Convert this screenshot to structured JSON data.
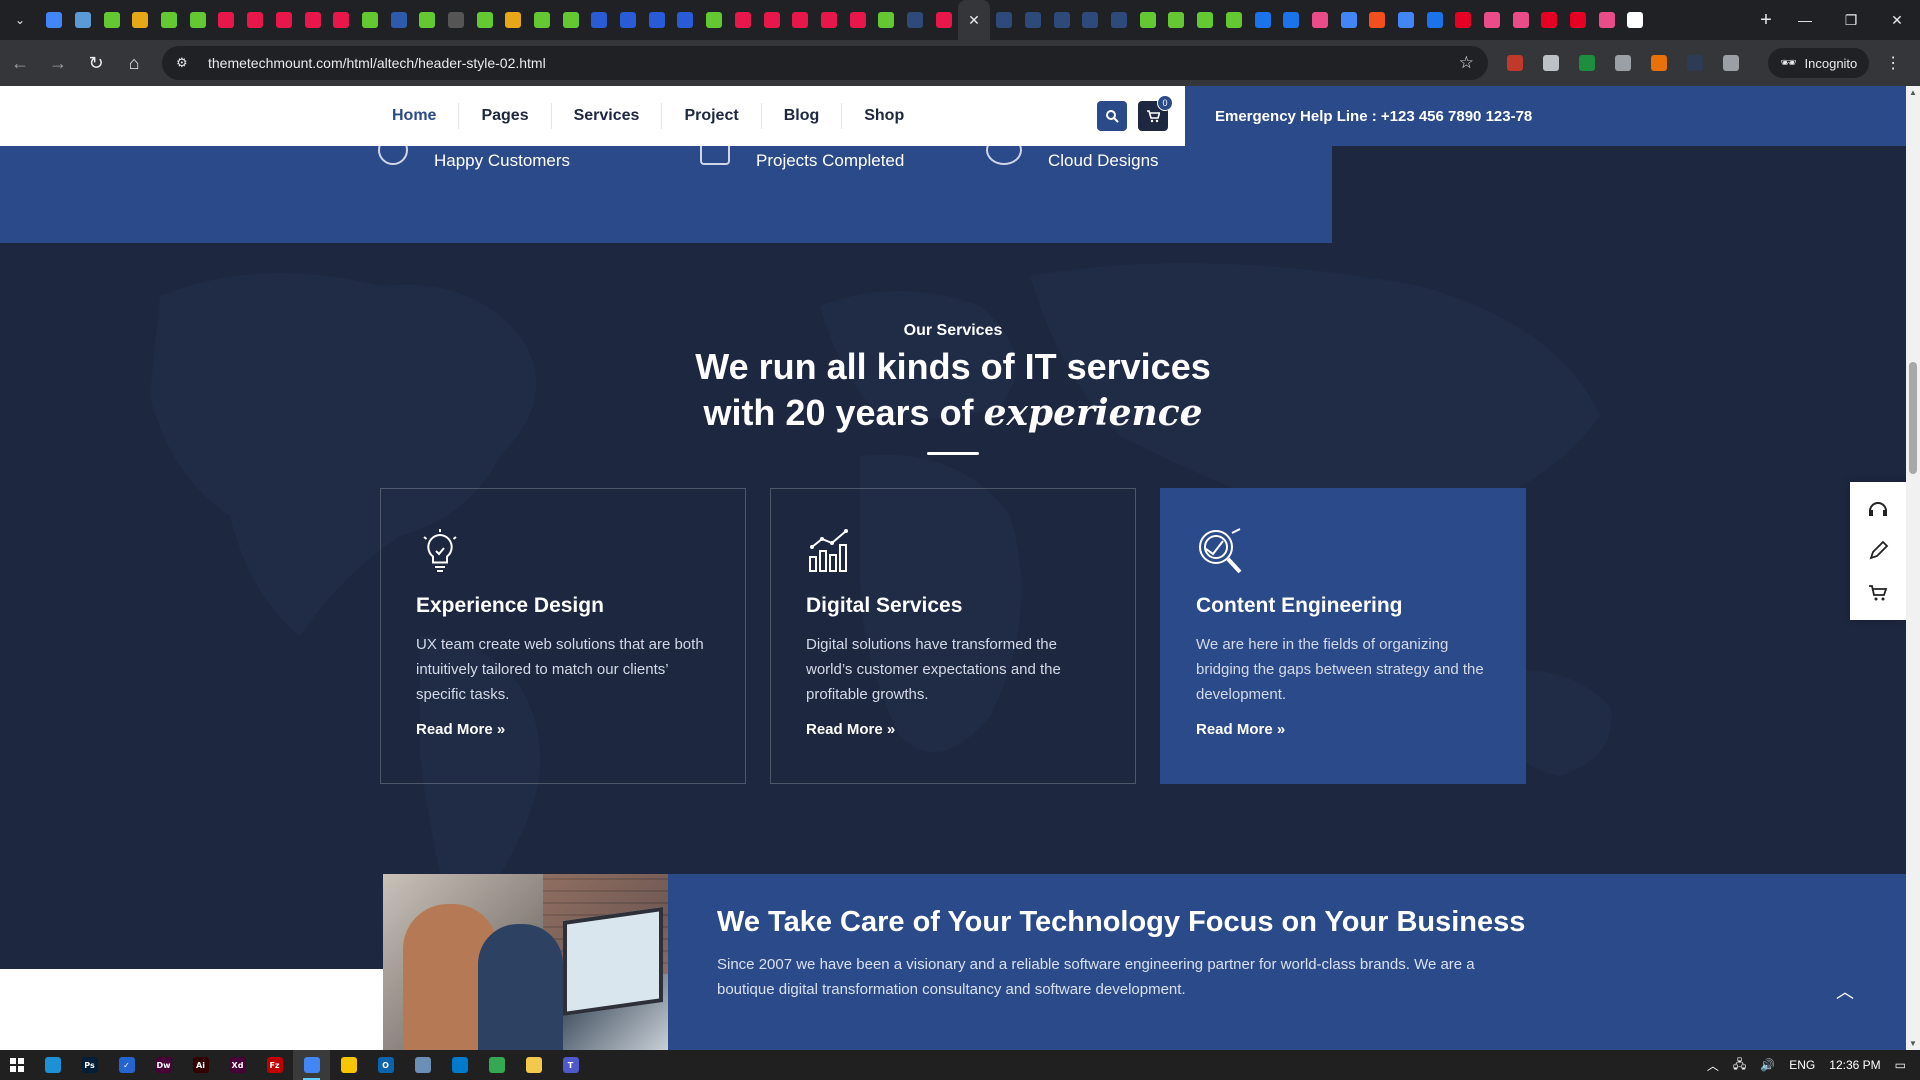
{
  "browser": {
    "tabs_favicon_colors": [
      "#4285f4",
      "#5b9bd5",
      "#64c832",
      "#e6a817",
      "#64c832",
      "#64c832",
      "#e8174b",
      "#e8174b",
      "#e8174b",
      "#e8174b",
      "#e8174b",
      "#64c832",
      "#2e5aac",
      "#64c832",
      "#555555",
      "#64c832",
      "#e6a817",
      "#64c832",
      "#64c832",
      "#2a5bd7",
      "#2a5bd7",
      "#2a5bd7",
      "#2a5bd7",
      "#64c832",
      "#e8174b",
      "#e8174b",
      "#e8174b",
      "#e8174b",
      "#e8174b",
      "#64c832",
      "#2e4a7a",
      "#e8174b"
    ],
    "tabs_after_active_colors": [
      "#2e4a7a",
      "#2e4a7a",
      "#2e4a7a",
      "#2e4a7a",
      "#2e4a7a",
      "#64c832",
      "#64c832",
      "#64c832",
      "#64c832",
      "#1a73e8",
      "#1a73e8",
      "#ea4c89",
      "#4285f4",
      "#f24e1e",
      "#4285f4",
      "#1a73e8",
      "#e60023",
      "#ea4c89",
      "#ea4c89",
      "#e60023",
      "#e60023",
      "#ea4c89",
      "#ffffff"
    ],
    "url": "themetechmount.com/html/altech/header-style-02.html",
    "incognito_label": "Incognito"
  },
  "header": {
    "nav": [
      "Home",
      "Pages",
      "Services",
      "Project",
      "Blog",
      "Shop"
    ],
    "active_nav": "Home",
    "cart_count": "0",
    "emergency": "Emergency Help Line : +123 456 7890 123-78"
  },
  "counters": [
    "Happy Customers",
    "Projects Completed",
    "Cloud Designs"
  ],
  "services": {
    "subtitle": "Our Services",
    "title_line1": "We run all kinds of IT services",
    "title_line2_plain": "with 20 years of",
    "title_line2_accent": "experience",
    "cards": [
      {
        "icon": "lightbulb-icon",
        "title": "Experience Design",
        "text": "UX team create web solutions that are both intuitively tailored to match our clients’ specific tasks.",
        "link": "Read More"
      },
      {
        "icon": "bar-chart-icon",
        "title": "Digital Services",
        "text": "Digital solutions have transformed the world’s customer expectations and the profitable growths.",
        "link": "Read More"
      },
      {
        "icon": "magnifier-icon",
        "title": "Content Engineering",
        "text": "We are here in the fields of organizing bridging the gaps between strategy and the development.",
        "link": "Read More"
      }
    ]
  },
  "banner": {
    "title": "We Take Care of Your Technology Focus on Your Business",
    "text": "Since 2007 we have been a visionary and a reliable software engineering partner for world-class brands. We are a boutique digital transformation consultancy and software development."
  },
  "colors": {
    "primary": "#2b4a8a",
    "dark_bg": "#1d2740",
    "white": "#ffffff"
  },
  "taskbar": {
    "apps": [
      {
        "name": "edge",
        "color": "#1e90d6",
        "label": ""
      },
      {
        "name": "photoshop",
        "color": "#001e36",
        "label": "Ps"
      },
      {
        "name": "todo",
        "color": "#2564cf",
        "label": "✓"
      },
      {
        "name": "dreamweaver",
        "color": "#470137",
        "label": "Dw"
      },
      {
        "name": "illustrator",
        "color": "#330000",
        "label": "Ai"
      },
      {
        "name": "xd",
        "color": "#470137",
        "label": "Xd"
      },
      {
        "name": "filezilla",
        "color": "#bf0000",
        "label": "Fz"
      },
      {
        "name": "chrome",
        "color": "#4285f4",
        "label": ""
      },
      {
        "name": "sticky-notes",
        "color": "#f7c600",
        "label": ""
      },
      {
        "name": "outlook",
        "color": "#0a64ad",
        "label": "O"
      },
      {
        "name": "notepad",
        "color": "#6b8fb7",
        "label": ""
      },
      {
        "name": "vscode",
        "color": "#007acc",
        "label": ""
      },
      {
        "name": "chrome-2",
        "color": "#34a853",
        "label": ""
      },
      {
        "name": "file-explorer",
        "color": "#f2c94c",
        "label": ""
      },
      {
        "name": "teams",
        "color": "#5059c9",
        "label": "T"
      }
    ],
    "active_app": "chrome",
    "language": "ENG",
    "time": "12:36 PM"
  }
}
